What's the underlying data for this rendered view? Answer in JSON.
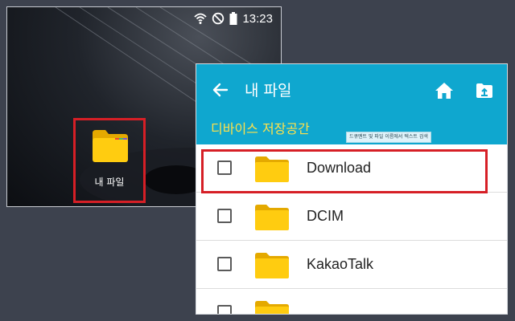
{
  "status_bar": {
    "time": "13:23",
    "icons": [
      "wifi-icon",
      "no-sound-icon",
      "battery-icon"
    ]
  },
  "home_app": {
    "label": "내 파일",
    "icon": "folder-icon"
  },
  "file_manager": {
    "title": "내 파일",
    "storage_title": "디바이스 저장공간",
    "tooltip": "드큐멘트 및 파일 이름에서 텍스트 검색",
    "items": [
      {
        "name": "Download",
        "icon": "folder-icon",
        "checked": false
      },
      {
        "name": "DCIM",
        "icon": "folder-icon",
        "checked": false
      },
      {
        "name": "KakaoTalk",
        "icon": "folder-icon",
        "checked": false
      },
      {
        "name": "",
        "icon": "folder-icon",
        "checked": false
      }
    ]
  },
  "colors": {
    "header": "#0fa7cf",
    "storage_title": "#ffe14a",
    "highlight": "#d61f26",
    "folder": "#ffcc10"
  }
}
